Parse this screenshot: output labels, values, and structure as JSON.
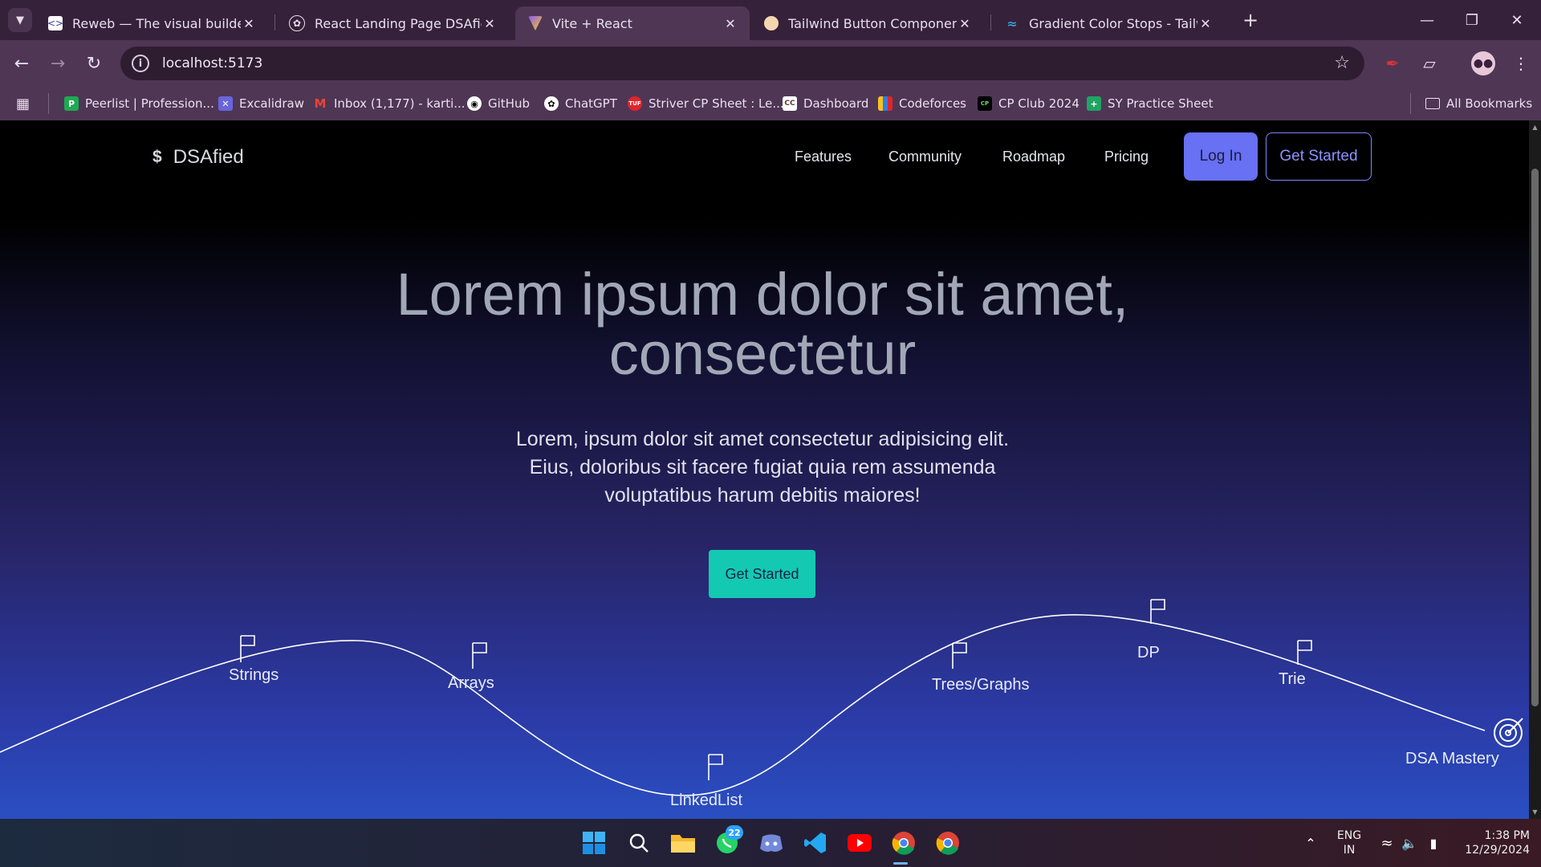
{
  "browser": {
    "tabs": [
      {
        "title": "Reweb — The visual builder for",
        "favicon": "reweb-icon",
        "active": false
      },
      {
        "title": "React Landing Page DSAfied",
        "favicon": "openai-icon",
        "active": false
      },
      {
        "title": "Vite + React",
        "favicon": "vite-icon",
        "active": true
      },
      {
        "title": "Tailwind Button Component —",
        "favicon": "tailwind-component-icon",
        "active": false
      },
      {
        "title": "Gradient Color Stops - Tailwind",
        "favicon": "tailwind-icon",
        "active": false
      }
    ],
    "url": "localhost:5173",
    "bookmarks": [
      {
        "label": "Peerlist | Profession...",
        "icon": "peerlist-icon"
      },
      {
        "label": "Excalidraw",
        "icon": "excalidraw-icon"
      },
      {
        "label": "Inbox (1,177) - karti...",
        "icon": "gmail-icon"
      },
      {
        "label": "GitHub",
        "icon": "github-icon"
      },
      {
        "label": "ChatGPT",
        "icon": "chatgpt-icon"
      },
      {
        "label": "Striver CP Sheet : Le...",
        "icon": "tuf-icon"
      },
      {
        "label": "Dashboard",
        "icon": "codechef-icon"
      },
      {
        "label": "Codeforces",
        "icon": "codeforces-icon"
      },
      {
        "label": "CP Club 2024",
        "icon": "cpclub-icon"
      },
      {
        "label": "SY Practice Sheet",
        "icon": "sheets-icon"
      }
    ],
    "all_bookmarks": "All Bookmarks"
  },
  "site": {
    "brand": "DSAfied",
    "brand_symbol": "$",
    "nav": [
      "Features",
      "Community",
      "Roadmap",
      "Pricing"
    ],
    "login": "Log In",
    "get_started": "Get Started",
    "hero": {
      "title_line1": "Lorem ipsum dolor sit amet,",
      "title_line2": "consectetur",
      "subtitle": "Lorem, ipsum dolor sit amet consectetur adipisicing elit. Eius, doloribus sit facere fugiat quia rem assumenda voluptatibus harum debitis maiores!",
      "cta": "Get Started"
    },
    "roadmap": [
      "Strings",
      "Arrays",
      "LinkedList",
      "Trees/Graphs",
      "DP",
      "Trie",
      "DSA Mastery"
    ]
  },
  "taskbar": {
    "apps": [
      "windows-start-icon",
      "search-icon",
      "file-explorer-icon",
      "whatsapp-icon",
      "discord-icon",
      "vscode-icon",
      "youtube-icon",
      "chrome-icon",
      "chrome-icon"
    ],
    "whatsapp_badge": "22",
    "lang_top": "ENG",
    "lang_bottom": "IN",
    "time": "1:38 PM",
    "date": "12/29/2024"
  },
  "colors": {
    "accent": "#6870f3",
    "cta": "#14c9b1",
    "chrome_frame": "#36213a",
    "chrome_toolbar": "#4f3655"
  }
}
